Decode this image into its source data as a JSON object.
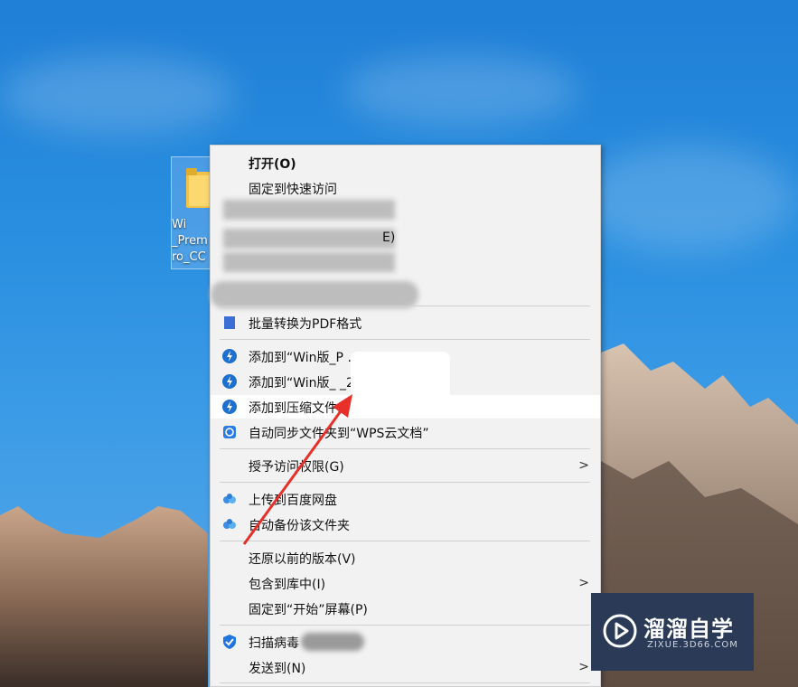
{
  "desktop": {
    "icon_label": "Wi\n_Prem\nro_CC"
  },
  "menu": {
    "items": [
      {
        "label": "打开(O)",
        "bold": true
      },
      {
        "label": "固定到快速访问"
      },
      {
        "label": "E)"
      },
      {
        "label": "批量转换为PDF格式"
      },
      {
        "label": "添加到“Win版_P      ...ip”"
      },
      {
        "label": "添加到“Win版_       _2018.7z”"
      },
      {
        "label": "添加到压缩文件..."
      },
      {
        "label": "自动同步文件夹到“WPS云文档”"
      },
      {
        "label": "授予访问权限(G)"
      },
      {
        "label": "上传到百度网盘"
      },
      {
        "label": "自动备份该文件夹"
      },
      {
        "label": "还原以前的版本(V)"
      },
      {
        "label": "包含到库中(I)"
      },
      {
        "label": "固定到“开始”屏幕(P)"
      },
      {
        "label": "扫描病毒"
      },
      {
        "label": "发送到(N)"
      }
    ]
  },
  "watermark": {
    "title": "溜溜自学",
    "subtitle": "ZIXUE.3D66.COM"
  },
  "colors": {
    "accent_blue": "#1f7fd6",
    "arrow_red": "#e8302a"
  }
}
